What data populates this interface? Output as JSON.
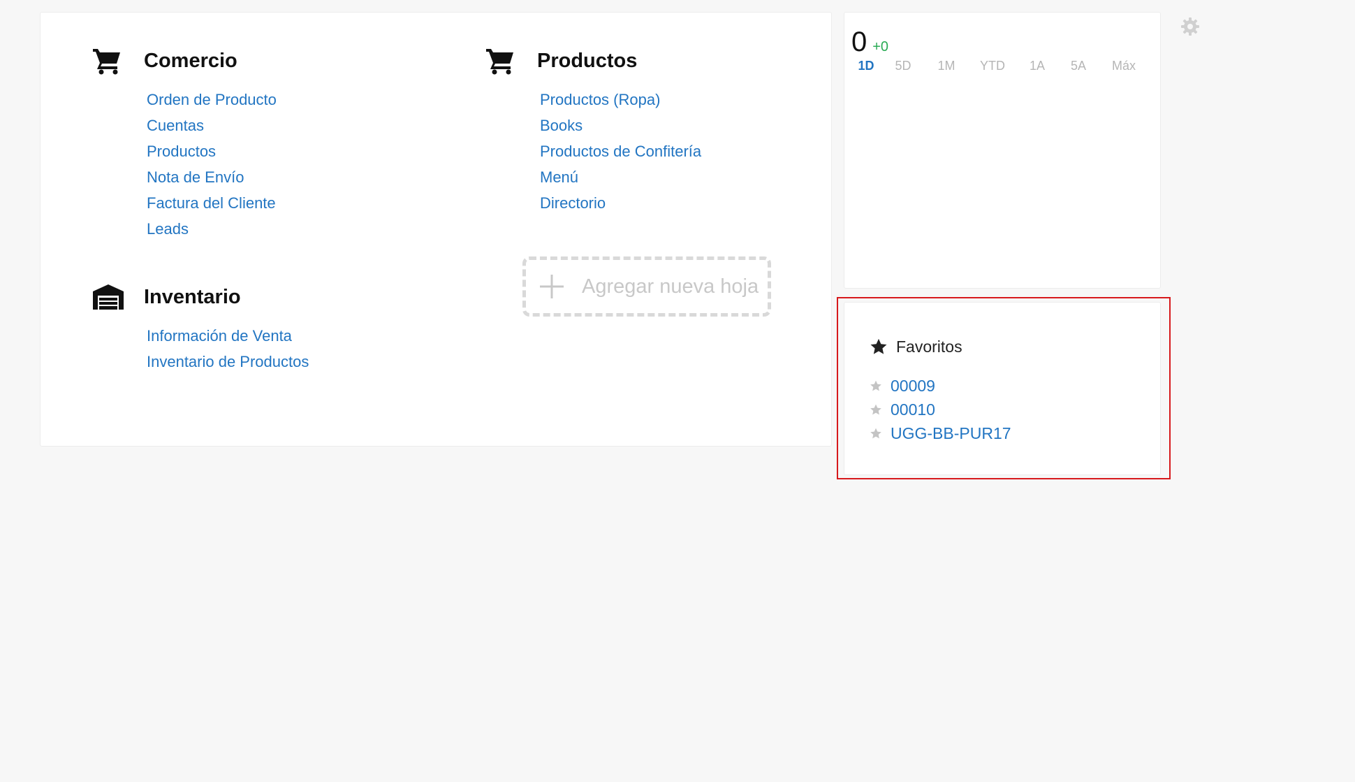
{
  "workspace": {
    "sections": [
      {
        "title": "Comercio",
        "icon": "shopping-cart-icon",
        "links": [
          "Orden de Producto",
          "Cuentas",
          "Productos",
          "Nota de Envío",
          "Factura del Cliente",
          "Leads"
        ]
      },
      {
        "title": "Productos",
        "icon": "shopping-cart-icon",
        "links": [
          "Productos (Ropa)",
          "Books",
          "Productos de Confitería",
          "Menú",
          "Directorio"
        ]
      },
      {
        "title": "Inventario",
        "icon": "warehouse-icon",
        "links": [
          "Información de Venta",
          "Inventario de Productos"
        ]
      }
    ],
    "add_sheet_label": "Agregar nueva hoja"
  },
  "stock_widget": {
    "value": "0",
    "change": "+0",
    "change_color": "#2bab55",
    "ranges": [
      "1D",
      "5D",
      "1M",
      "YTD",
      "1A",
      "5A",
      "Máx"
    ],
    "active_range": "1D"
  },
  "favorites": {
    "title": "Favoritos",
    "items": [
      "00009",
      "00010",
      "UGG-BB-PUR17"
    ]
  },
  "colors": {
    "link": "#2275c2",
    "highlight_border": "#d7191c",
    "background": "#f7f7f7"
  }
}
